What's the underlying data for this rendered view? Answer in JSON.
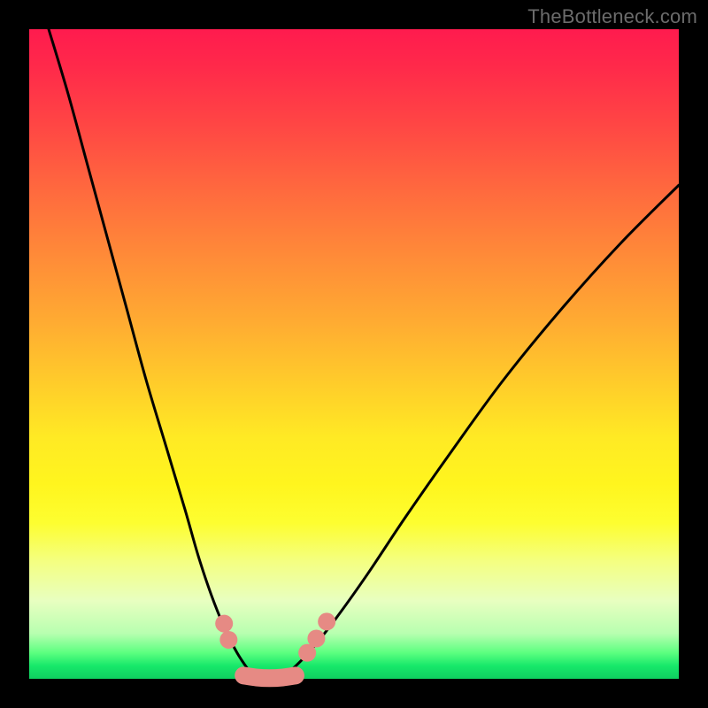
{
  "watermark": "TheBottleneck.com",
  "colors": {
    "background": "#000000",
    "curve": "#000000",
    "marker": "#e68a84"
  },
  "chart_data": {
    "type": "line",
    "title": "",
    "xlabel": "",
    "ylabel": "",
    "xlim": [
      0,
      100
    ],
    "ylim": [
      0,
      100
    ],
    "grid": false,
    "series": [
      {
        "name": "left-curve",
        "x": [
          3,
          6,
          9,
          12,
          15,
          18,
          21,
          24,
          26,
          28,
          30,
          32,
          34
        ],
        "values": [
          100,
          90,
          79,
          68,
          57,
          46,
          36,
          26,
          19,
          13,
          8,
          4,
          1
        ]
      },
      {
        "name": "right-curve",
        "x": [
          40,
          43,
          47,
          52,
          58,
          65,
          73,
          82,
          91,
          100
        ],
        "values": [
          1,
          4,
          9,
          16,
          25,
          35,
          46,
          57,
          67,
          76
        ]
      },
      {
        "name": "floor-segment",
        "x": [
          33,
          35,
          37,
          39,
          41
        ],
        "values": [
          0.5,
          0.2,
          0.1,
          0.2,
          0.5
        ]
      }
    ],
    "markers": [
      {
        "x": 30.0,
        "y": 8.5
      },
      {
        "x": 30.7,
        "y": 6.0
      },
      {
        "x": 42.8,
        "y": 4.0
      },
      {
        "x": 44.2,
        "y": 6.2
      },
      {
        "x": 45.8,
        "y": 8.8
      }
    ],
    "annotations": []
  }
}
